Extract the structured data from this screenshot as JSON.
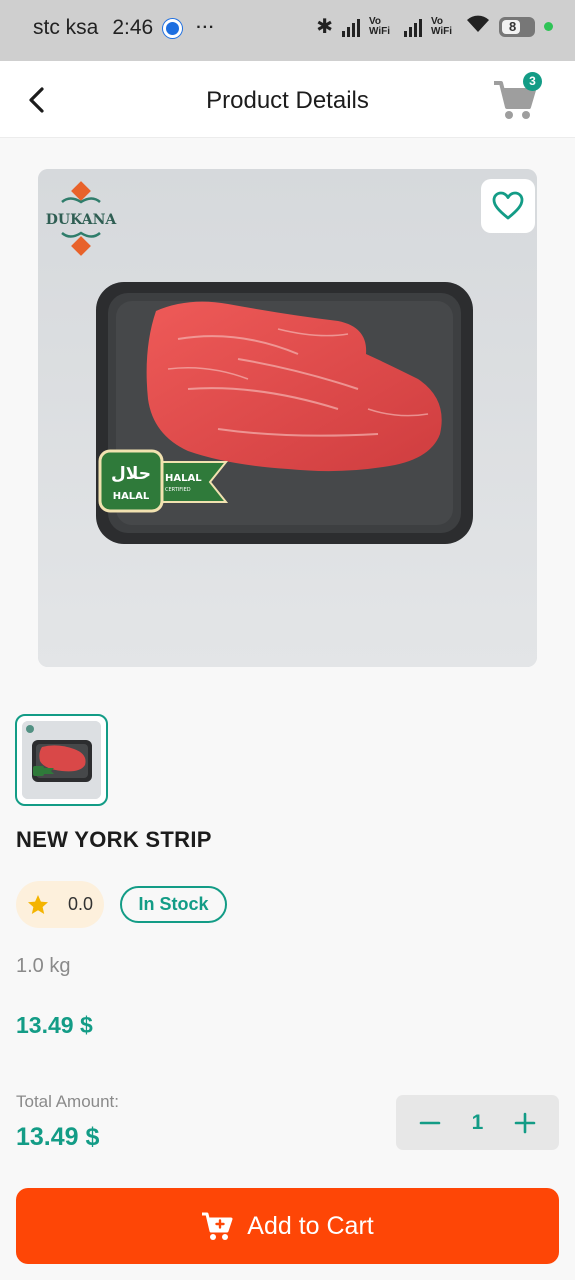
{
  "status_bar": {
    "carrier": "stc ksa",
    "time": "2:46",
    "more": "···",
    "vowifi_1": "Vo WiFi",
    "vowifi_2": "Vo WiFi",
    "battery": "8"
  },
  "header": {
    "title": "Product Details",
    "cart_count": "3"
  },
  "product": {
    "brand": "DUKANA",
    "halal_arabic": "حلال",
    "halal_badge_label": "HALAL",
    "halal_ribbon_label": "HALAL",
    "halal_ribbon_sub": "CERTIFIED",
    "name": "NEW YORK STRIP",
    "rating": "0.0",
    "stock_status": "In Stock",
    "weight": "1.0 kg",
    "price": "13.49 $"
  },
  "total": {
    "label": "Total Amount:",
    "value": "13.49 $"
  },
  "quantity": {
    "value": "1",
    "decrement": "−",
    "increment": "+"
  },
  "actions": {
    "add_to_cart": "Add to Cart"
  },
  "colors": {
    "accent": "#139c86",
    "cta": "#fe4606",
    "rating_bg": "#fdf0dc",
    "star": "#f4b400"
  },
  "icons": [
    "back-arrow-icon",
    "cart-icon",
    "heart-icon",
    "star-icon",
    "minus-icon",
    "plus-icon",
    "add-cart-icon"
  ]
}
